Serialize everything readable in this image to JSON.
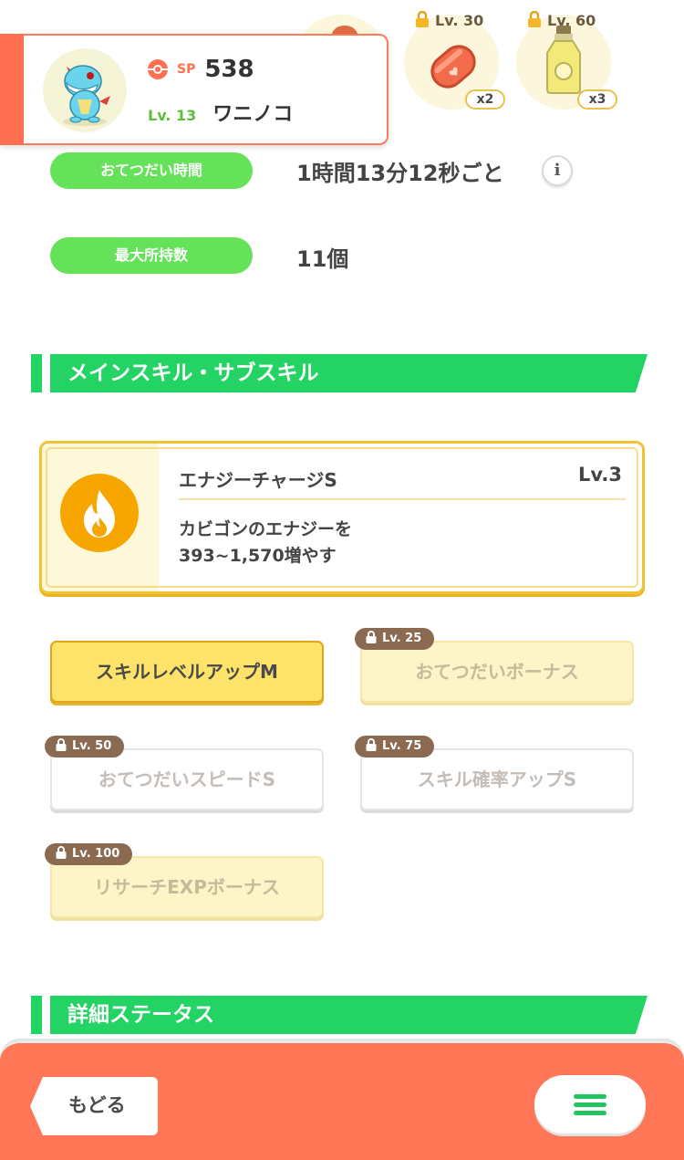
{
  "ingredients": [
    {
      "lock_level": "Lv. 30",
      "count": "x2",
      "icon": "sausage-icon"
    },
    {
      "lock_level": "Lv. 60",
      "count": "x3",
      "icon": "oil-bottle-icon"
    }
  ],
  "pokemon": {
    "sp_label": "SP",
    "sp_value": "538",
    "level": "Lv. 13",
    "name": "ワニノコ"
  },
  "info": {
    "help_time_label": "おてつだい時間",
    "help_time_value": "1時間13分12秒ごと",
    "max_carry_label": "最大所持数",
    "max_carry_value": "11個"
  },
  "sections": {
    "skills_title": "メインスキル・サブスキル",
    "details_title": "詳細ステータス"
  },
  "main_skill": {
    "name": "エナジーチャージS",
    "level": "Lv.3",
    "desc_line1": "カビゴンのエナジーを",
    "desc_line2": "393~1,570増やす",
    "icon": "flame-icon",
    "accent": "#f7a600"
  },
  "sub_skills": [
    {
      "label": "スキルレベルアップM",
      "lock": ""
    },
    {
      "label": "おてつだいボーナス",
      "lock": "Lv. 25"
    },
    {
      "label": "おてつだいスピードS",
      "lock": "Lv. 50"
    },
    {
      "label": "スキル確率アップS",
      "lock": "Lv. 75"
    },
    {
      "label": "リサーチEXPボーナス",
      "lock": "Lv. 100"
    }
  ],
  "nav": {
    "back_label": "もどる",
    "menu_icon": "hamburger-menu-icon"
  },
  "colors": {
    "green": "#23d364",
    "coral": "#ff7757",
    "gold": "#f1c232"
  }
}
